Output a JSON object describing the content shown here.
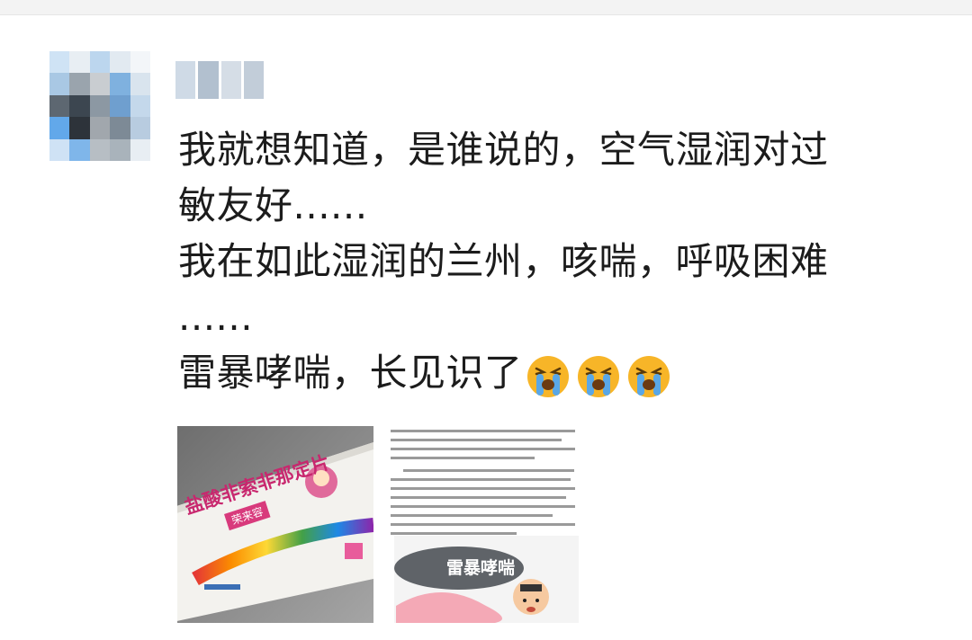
{
  "post": {
    "lines": [
      "我就想知道，是谁说的，空气湿润对过",
      "敏友好......",
      "我在如此湿润的兰州，咳喘，呼吸困难",
      "......",
      "雷暴哮喘，长见识了"
    ],
    "emoji": "cry-emoji",
    "emoji_count": 3
  },
  "images": {
    "medicine_box": {
      "title": "盐酸非索非那定片",
      "brand": "荣来容"
    },
    "article": {
      "banner": "雷暴哮喘"
    }
  },
  "colors": {
    "text": "#1c1c1c",
    "background": "#ffffff",
    "emoji_face": "#f7b528",
    "emoji_tear": "#5aa7e6"
  }
}
